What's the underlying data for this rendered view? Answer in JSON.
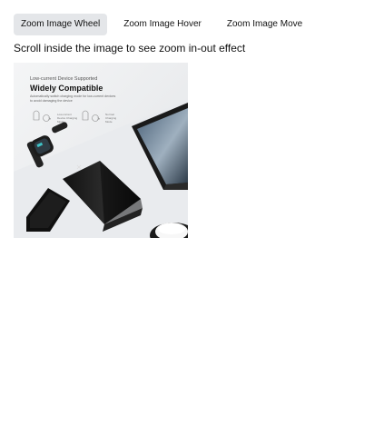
{
  "tabs": [
    {
      "label": "Zoom Image Wheel"
    },
    {
      "label": "Zoom Image Hover"
    },
    {
      "label": "Zoom Image Move"
    }
  ],
  "hint": "Scroll inside the image to see zoom in-out effect",
  "product_image": {
    "eyebrow": "Low-current Device Supported",
    "headline": "Widely Compatible",
    "body_line1": "Automatically switch charging mode for low-current devices",
    "body_line2": "to avoid damaging the device",
    "step1_line1": "Low-current",
    "step1_line2": "Device Charging",
    "step1_line3": "Mode",
    "step2_line1": "Normal",
    "step2_line2": "Charging",
    "step2_line3": "Mode",
    "timer": "3s"
  }
}
